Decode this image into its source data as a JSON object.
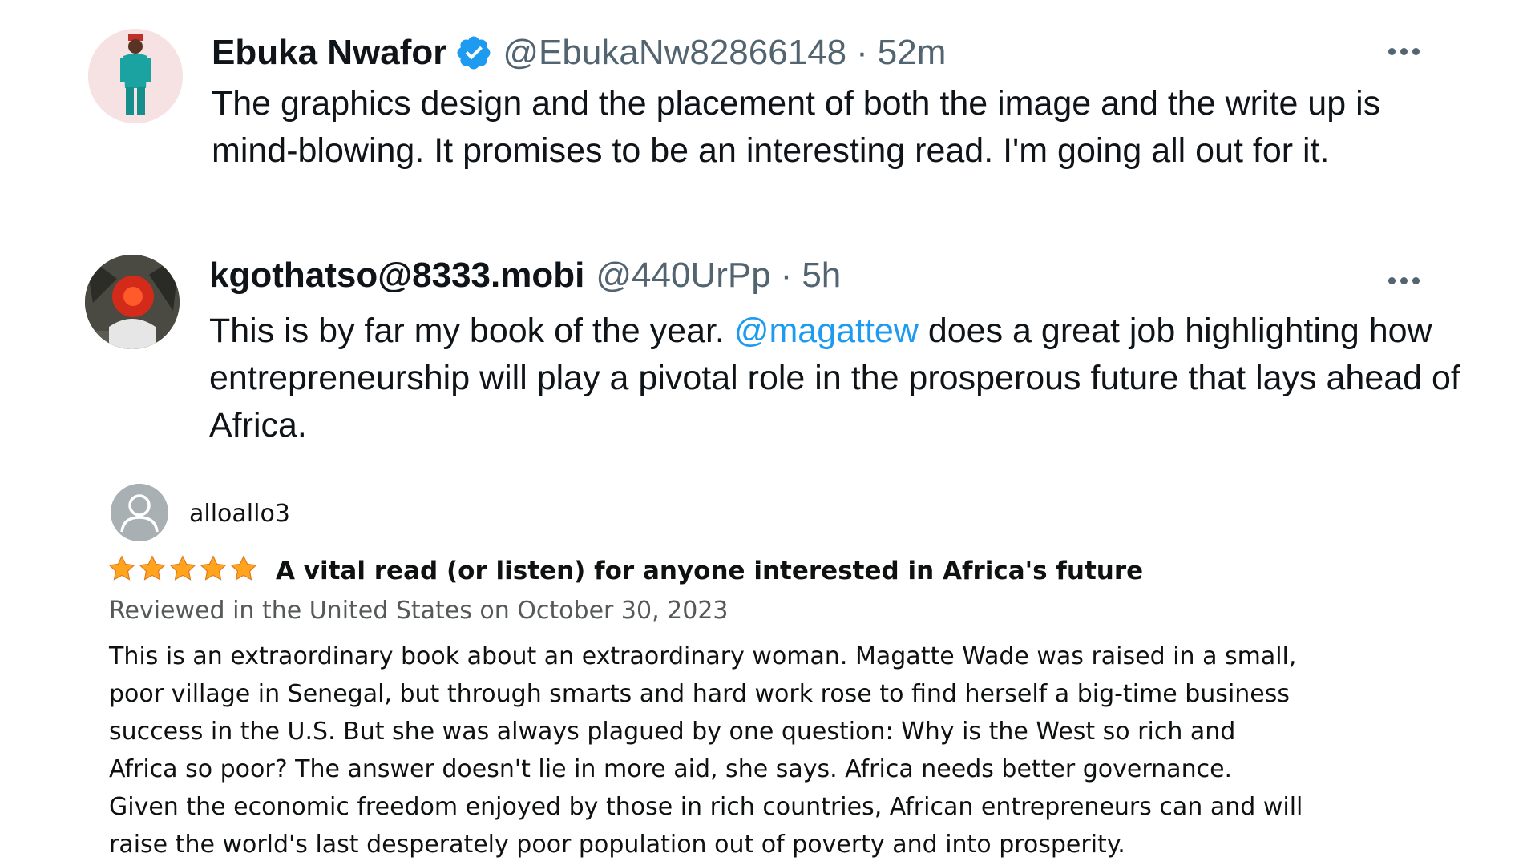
{
  "tweets": [
    {
      "name": "Ebuka Nwafor",
      "verified": true,
      "handle": "@EbukaNw82866148",
      "separator": "·",
      "time": "52m",
      "text": "The graphics design and the placement of both the image and the write up is mind-blowing. It promises to be an interesting read. I'm going all out for it.",
      "avatar_icon": "profile-photo-icon"
    },
    {
      "name": "kgothatso@8333.mobi",
      "verified": false,
      "handle": "@440UrPp",
      "separator": "·",
      "time": "5h",
      "text_before": "This is by far my book of the year. ",
      "mention": "@magattew",
      "text_after": " does a great job highlighting how entrepreneurship will play a pivotal role in the prosperous future that lays ahead of Africa.",
      "avatar_icon": "profile-photo-icon"
    }
  ],
  "review": {
    "reviewer": "alloallo3",
    "rating": 5,
    "rating_max": 5,
    "title": "A vital read (or listen) for anyone interested in Africa's future",
    "meta": "Reviewed in the United States on October 30, 2023",
    "text": "This is an extraordinary book about an extraordinary woman. Magatte Wade was raised in a small, poor village in Senegal, but through smarts and hard work rose to find herself a big-time business success in the U.S. But she was always plagued by one question: Why is the West so rich and Africa so poor? The answer doesn't lie in more aid, she says. Africa needs better governance. Given the economic freedom enjoyed by those in rich countries, African entrepreneurs can and will raise the world's last desperately poor population out of poverty and into prosperity.",
    "avatar_icon": "default-user-icon"
  },
  "colors": {
    "twitter_blue": "#1d9bf0",
    "text_primary": "#0f1419",
    "text_secondary": "#536471",
    "star_orange": "#ffa41c",
    "amazon_meta": "#565959"
  }
}
